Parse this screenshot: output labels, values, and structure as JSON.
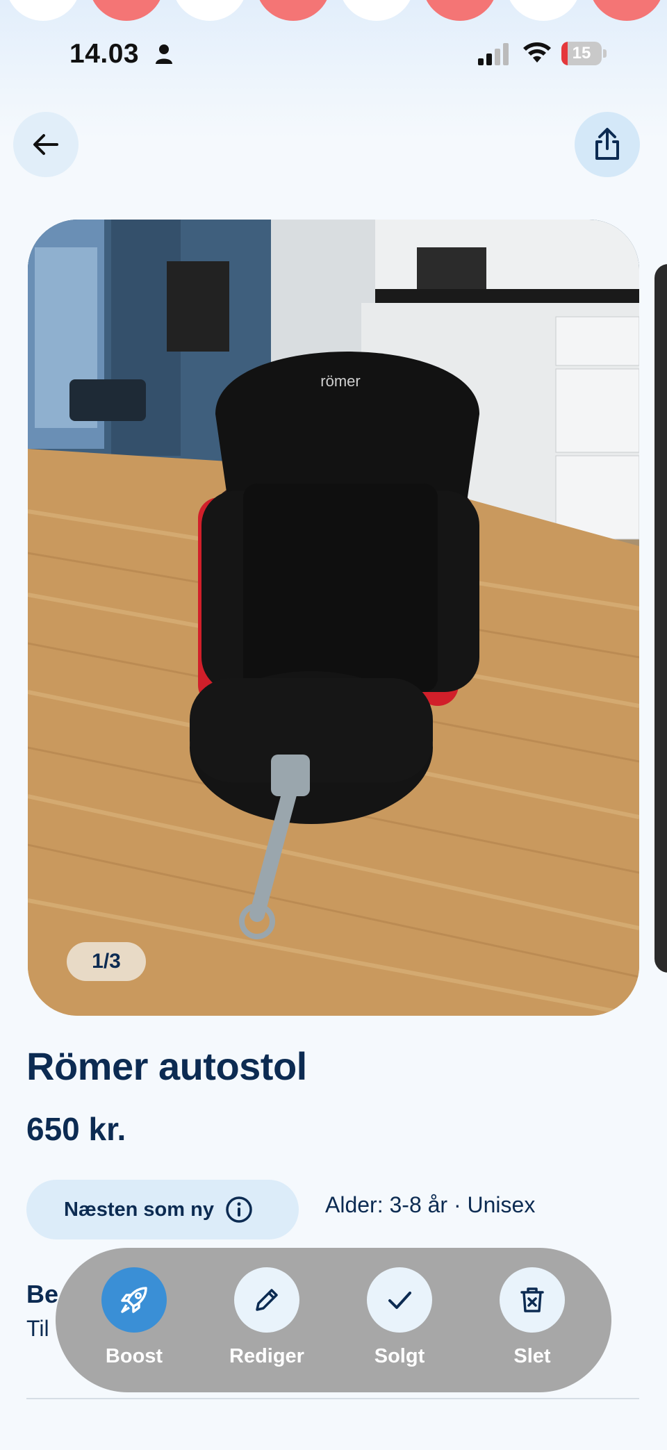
{
  "status_bar": {
    "time": "14.03",
    "battery": "15",
    "battery_level": 0.15
  },
  "header": {
    "back_icon": "arrow-left-icon",
    "share_icon": "share-icon"
  },
  "carousel": {
    "counter": "1/3",
    "photo_subject": "car-seat-photo"
  },
  "listing": {
    "title": "Römer autostol",
    "price": "650 kr.",
    "condition": "Næsten som ny",
    "meta": "Alder: 3-8 år · Unisex",
    "desc_heading_visible": "Be",
    "desc_text_visible": "Til"
  },
  "actions": [
    {
      "label": "Boost",
      "icon": "rocket-icon"
    },
    {
      "label": "Rediger",
      "icon": "pencil-icon"
    },
    {
      "label": "Solgt",
      "icon": "check-icon"
    },
    {
      "label": "Slet",
      "icon": "trash-icon"
    }
  ],
  "colors": {
    "primary": "#3a8fd6",
    "text": "#0c2b52",
    "deco_red": "#f47575",
    "chip": "#dcecf9"
  }
}
